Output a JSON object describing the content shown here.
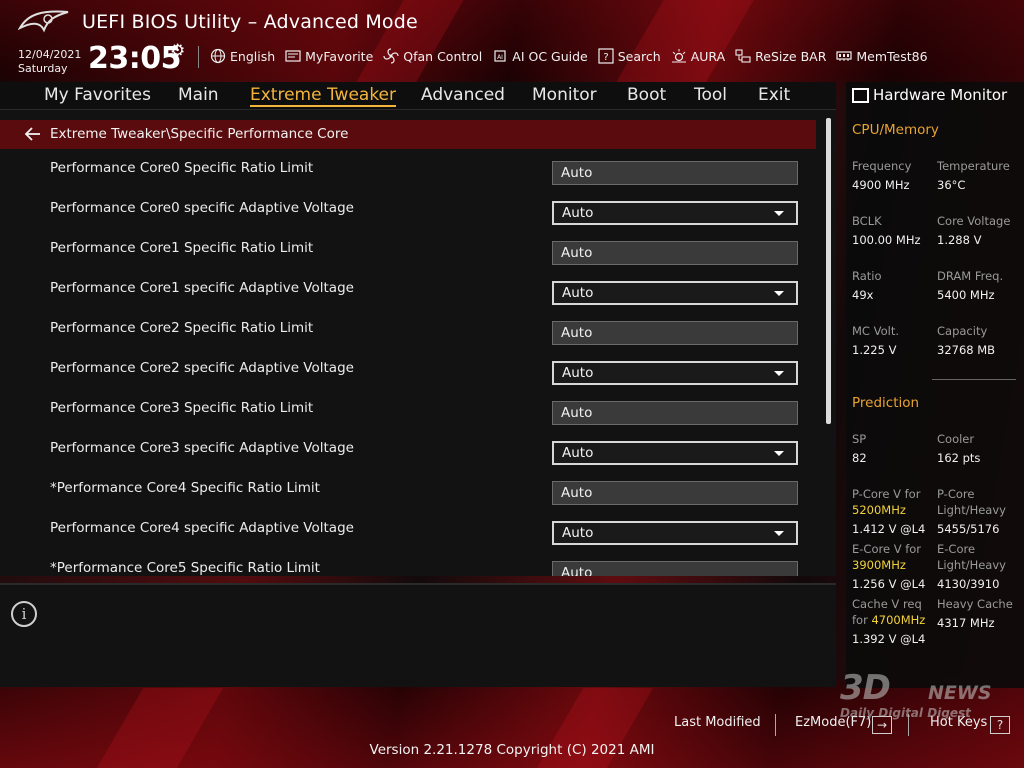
{
  "header": {
    "title": "UEFI BIOS Utility – Advanced Mode",
    "date": "12/04/2021",
    "day": "Saturday",
    "time": "23:05",
    "tools": [
      {
        "label": "English",
        "icon": "globe-icon"
      },
      {
        "label": "MyFavorite",
        "icon": "favorite-icon"
      },
      {
        "label": "Qfan Control",
        "icon": "fan-icon"
      },
      {
        "label": "AI OC Guide",
        "icon": "ai-chip-icon"
      },
      {
        "label": "Search",
        "icon": "search-question-icon"
      },
      {
        "label": "AURA",
        "icon": "aura-light-icon"
      },
      {
        "label": "ReSize BAR",
        "icon": "resize-bar-icon"
      },
      {
        "label": "MemTest86",
        "icon": "memory-icon"
      }
    ]
  },
  "menu": {
    "items": [
      "My Favorites",
      "Main",
      "Extreme Tweaker",
      "Advanced",
      "Monitor",
      "Boot",
      "Tool",
      "Exit"
    ],
    "active": "Extreme Tweaker"
  },
  "breadcrumb": "Extreme Tweaker\\Specific Performance Core",
  "settings": [
    {
      "label": "Performance Core0 Specific Ratio Limit",
      "value": "Auto",
      "type": "text"
    },
    {
      "label": "Performance Core0 specific Adaptive Voltage",
      "value": "Auto",
      "type": "select"
    },
    {
      "label": "Performance Core1 Specific Ratio Limit",
      "value": "Auto",
      "type": "text"
    },
    {
      "label": "Performance Core1 specific Adaptive Voltage",
      "value": "Auto",
      "type": "select"
    },
    {
      "label": "Performance Core2 Specific Ratio Limit",
      "value": "Auto",
      "type": "text"
    },
    {
      "label": "Performance Core2 specific Adaptive Voltage",
      "value": "Auto",
      "type": "select"
    },
    {
      "label": "Performance Core3 Specific Ratio Limit",
      "value": "Auto",
      "type": "text"
    },
    {
      "label": "Performance Core3 specific Adaptive Voltage",
      "value": "Auto",
      "type": "select"
    },
    {
      "label": "*Performance Core4 Specific Ratio Limit",
      "value": "Auto",
      "type": "text"
    },
    {
      "label": "Performance Core4 specific Adaptive Voltage",
      "value": "Auto",
      "type": "select"
    },
    {
      "label": "*Performance Core5 Specific Ratio Limit",
      "value": "Auto",
      "type": "text"
    }
  ],
  "hardware_monitor": {
    "title": "Hardware Monitor",
    "cpu_memory": {
      "heading": "CPU/Memory",
      "frequency_label": "Frequency",
      "frequency": "4900 MHz",
      "temperature_label": "Temperature",
      "temperature": "36°C",
      "bclk_label": "BCLK",
      "bclk": "100.00 MHz",
      "core_voltage_label": "Core Voltage",
      "core_voltage": "1.288 V",
      "ratio_label": "Ratio",
      "ratio": "49x",
      "dram_freq_label": "DRAM Freq.",
      "dram_freq": "5400 MHz",
      "mc_volt_label": "MC Volt.",
      "mc_volt": "1.225 V",
      "capacity_label": "Capacity",
      "capacity": "32768 MB"
    },
    "prediction": {
      "heading": "Prediction",
      "sp_label": "SP",
      "sp": "82",
      "cooler_label": "Cooler",
      "cooler": "162 pts",
      "pcore_v_label": "P-Core V for",
      "pcore_v_freq": "5200MHz",
      "pcore_v": "1.412 V @L4",
      "pcore_lh_label_1": "P-Core",
      "pcore_lh_label_2": "Light/Heavy",
      "pcore_lh": "5455/5176",
      "ecore_v_label": "E-Core V for",
      "ecore_v_freq": "3900MHz",
      "ecore_v": "1.256 V @L4",
      "ecore_lh_label_1": "E-Core",
      "ecore_lh_label_2": "Light/Heavy",
      "ecore_lh": "4130/3910",
      "cache_v_label_1": "Cache V req",
      "cache_v_label_2": "for",
      "cache_v_freq": "4700MHz",
      "cache_v": "1.392 V @L4",
      "heavy_cache_label": "Heavy Cache",
      "heavy_cache": "4317 MHz"
    }
  },
  "footer": {
    "last_modified": "Last Modified",
    "ezmode": "EzMode(F7)",
    "ezmode_key": "→",
    "hot_keys": "Hot Keys",
    "hot_keys_key": "?",
    "copyright": "Version 2.21.1278 Copyright (C) 2021 AMI"
  },
  "watermark": {
    "brand": "3D",
    "news": "NEWS",
    "tagline": "Daily Digital Digest"
  },
  "colors": {
    "accent": "#f4b43c",
    "prediction_highlight": "#f2d23a",
    "breadcrumb_bg": "#5a0b0d"
  }
}
